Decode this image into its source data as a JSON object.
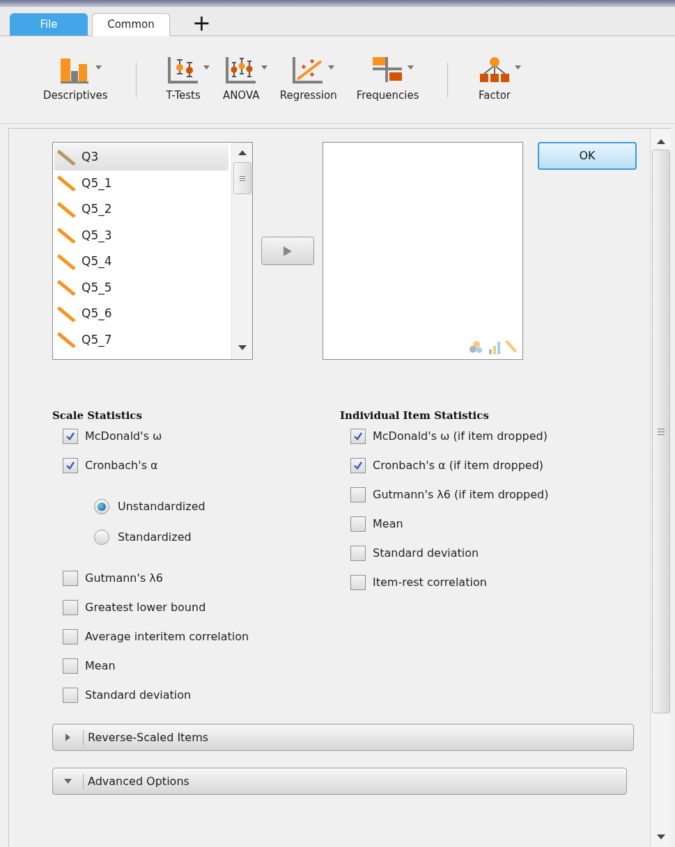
{
  "tabs": [
    {
      "label": "File",
      "kind": "file",
      "selected": false
    },
    {
      "label": "Common",
      "kind": "ribbon",
      "selected": true
    }
  ],
  "add_tab": "+",
  "toolbar": [
    {
      "kind": "descriptives",
      "label": "Descriptives"
    },
    {
      "kind": "separator"
    },
    {
      "kind": "ttests",
      "label": "T-Tests"
    },
    {
      "kind": "anova",
      "label": "ANOVA"
    },
    {
      "kind": "regression",
      "label": "Regression"
    },
    {
      "kind": "frequencies",
      "label": "Frequencies"
    },
    {
      "kind": "separator"
    },
    {
      "kind": "factor",
      "label": "Factor"
    }
  ],
  "variables": [
    {
      "name": "Q3",
      "selected": true
    },
    {
      "name": "Q5_1",
      "selected": false
    },
    {
      "name": "Q5_2",
      "selected": false
    },
    {
      "name": "Q5_3",
      "selected": false
    },
    {
      "name": "Q5_4",
      "selected": false
    },
    {
      "name": "Q5_5",
      "selected": false
    },
    {
      "name": "Q5_6",
      "selected": false
    },
    {
      "name": "Q5_7",
      "selected": false
    }
  ],
  "ok_button": "OK",
  "scale_statistics": {
    "title": "Scale Statistics",
    "options": [
      {
        "kind": "checkbox",
        "label": "McDonald's ω",
        "checked": true
      },
      {
        "kind": "checkbox",
        "label": "Cronbach's α",
        "checked": true
      },
      {
        "kind": "radio",
        "label": "Unstandardized",
        "selected": true
      },
      {
        "kind": "radio",
        "label": "Standardized",
        "selected": false
      },
      {
        "kind": "checkbox",
        "label": "Gutmann's λ6",
        "checked": false
      },
      {
        "kind": "checkbox",
        "label": "Greatest lower bound",
        "checked": false
      },
      {
        "kind": "checkbox",
        "label": "Average interitem correlation",
        "checked": false
      },
      {
        "kind": "checkbox",
        "label": "Mean",
        "checked": false
      },
      {
        "kind": "checkbox",
        "label": "Standard deviation",
        "checked": false
      }
    ]
  },
  "item_statistics": {
    "title": "Individual Item Statistics",
    "options": [
      {
        "kind": "checkbox",
        "label": "McDonald's ω (if item dropped)",
        "checked": true
      },
      {
        "kind": "checkbox",
        "label": "Cronbach's α (if item dropped)",
        "checked": true
      },
      {
        "kind": "checkbox",
        "label": "Gutmann's λ6 (if item dropped)",
        "checked": false
      },
      {
        "kind": "checkbox",
        "label": "Mean",
        "checked": false
      },
      {
        "kind": "checkbox",
        "label": "Standard deviation",
        "checked": false
      },
      {
        "kind": "checkbox",
        "label": "Item-rest correlation",
        "checked": false
      }
    ]
  },
  "sections": [
    {
      "label": "Reverse-Scaled Items",
      "expanded": false
    },
    {
      "label": "Advanced Options",
      "expanded": true
    }
  ]
}
